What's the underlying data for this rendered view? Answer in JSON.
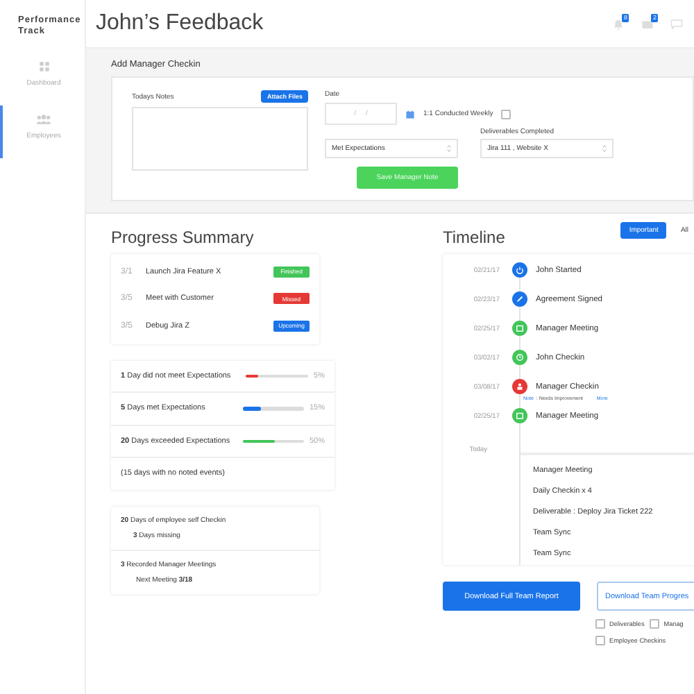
{
  "sidebar": {
    "brand": "Performance Track",
    "items": [
      {
        "label": "Dashboard",
        "selected": false
      },
      {
        "label": "Employees",
        "selected": true
      }
    ]
  },
  "header": {
    "title": "John’s Feedback",
    "badges": [
      "8",
      "2"
    ]
  },
  "checkin_form": {
    "heading": "Add Manager Checkin",
    "notes_label": "Todays Notes",
    "attach_button": "Attach Files",
    "date_label": "Date",
    "date_placeholder": "/     /",
    "weekly": {
      "label": "1:1 Conducted Weekly",
      "checked": false
    },
    "rating": "Met Expectations",
    "deliverables_label": "Deliverables Completed",
    "deliverables": "Jira 111 , Website X",
    "save_button": "Save Manager Note"
  },
  "progress": {
    "title": "Progress Summary",
    "tasks": [
      {
        "date": "3/1",
        "name": "Launch Jira Feature X",
        "status": "Finished",
        "kind": "finished"
      },
      {
        "date": "3/5",
        "name": "Meet with Customer",
        "status": "Missed",
        "kind": "missed"
      },
      {
        "date": "3/5",
        "name": "Debug Jira Z",
        "status": "Upcoming",
        "kind": "upcoming"
      }
    ],
    "stats": [
      {
        "text": "**1** Day did not meet Expectations",
        "level": 0.2,
        "reading": "5%",
        "color": "#e53935"
      },
      {
        "text": "**5** Days met Expectations",
        "level": 0.3,
        "reading": "15%",
        "color": "#1a73e8"
      },
      {
        "text": "**20** Days exceeded Expectations",
        "level": 0.52,
        "reading": "50%",
        "color": "#43c55a"
      }
    ],
    "stats_note": "(15 days with no noted events)",
    "checkins": [
      {
        "main": "**20** Days of employee self Checkin",
        "sub": "**3** Days missing"
      },
      {
        "main": "**3** Recorded Manager Meetings",
        "sub": "Next Meeting **3/18**"
      }
    ]
  },
  "timeline": {
    "title": "Timeline",
    "filters": [
      {
        "label": "Important",
        "selected": true
      },
      {
        "label": "All",
        "selected": false
      }
    ],
    "events": [
      {
        "date": "02/21/17",
        "title": "John Started",
        "kind": "power",
        "color": "#1a73e8"
      },
      {
        "date": "02/23/17",
        "title": "Agreement Signed",
        "kind": "pencil",
        "color": "#1a73e8"
      },
      {
        "date": "02/25/17",
        "title": "Manager Meeting",
        "kind": "calendar",
        "color": "#43c55a"
      },
      {
        "date": "03/02/17",
        "title": "John Checkin",
        "kind": "clock",
        "color": "#43c55a"
      },
      {
        "date": "03/08/17",
        "title": "Manager Checkin",
        "kind": "person",
        "color": "#e53935",
        "note_label": "Note",
        "note_text": ": Needs Improvement",
        "note_link": "More"
      },
      {
        "date": "02/25/17",
        "title": "Manager Meeting",
        "kind": "calendar",
        "color": "#43c55a"
      }
    ],
    "today_label": "Today",
    "today_items": [
      "Manager Meeting",
      "Daily Checkin x 4",
      "Deliverable : Deploy Jira Ticket 222",
      "Team Sync",
      "Team Sync"
    ]
  },
  "downloads": {
    "primary": "Download Full Team Report",
    "secondary": "Download Team Progres",
    "options": [
      {
        "label": "Deliverables",
        "checked": false
      },
      {
        "label": "Manag",
        "checked": false
      },
      {
        "label": "Employee Checkins",
        "checked": false
      }
    ]
  }
}
